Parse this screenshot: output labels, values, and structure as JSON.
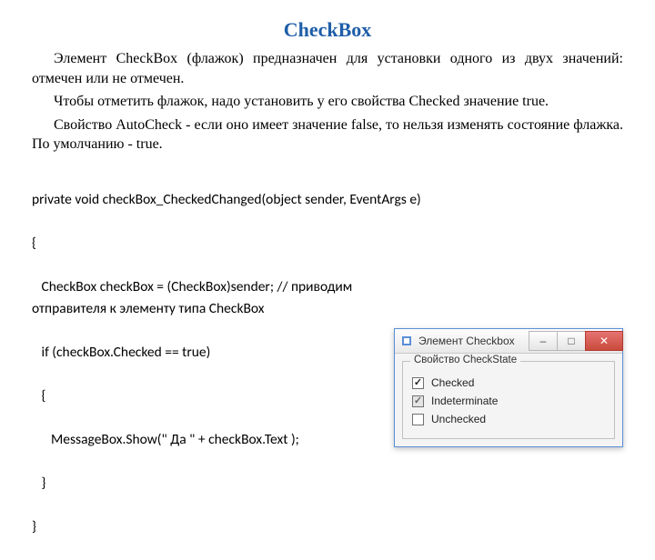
{
  "title": "CheckBox",
  "p1": "Элемент CheckBox (флажок) предназначен для установки одного из двух значений: отмечен или не отмечен.",
  "p2": "Чтобы отметить флажок, надо установить у его свойства Checked значение true.",
  "p3": "Свойство AutoCheck - если оно имеет значение false, то нельзя изменять состояние флажка. По умолчанию - true.",
  "code": {
    "l1": "private void checkBox_CheckedChanged(object sender, EventArgs e)",
    "l2": "{",
    "l3": "   CheckBox checkBox = (CheckBox)sender; // приводим отправителя к элементу типа CheckBox",
    "l4": "   if (checkBox.Checked == true)",
    "l5": "   {",
    "l6": "      MessageBox.Show(\" Да \" + checkBox.Text );",
    "l7": "   }",
    "l8": "}"
  },
  "window": {
    "title": "Элемент Checkbox",
    "group": "Свойство CheckState",
    "opt1": "Checked",
    "opt2": "Indeterminate",
    "opt3": "Unchecked"
  }
}
